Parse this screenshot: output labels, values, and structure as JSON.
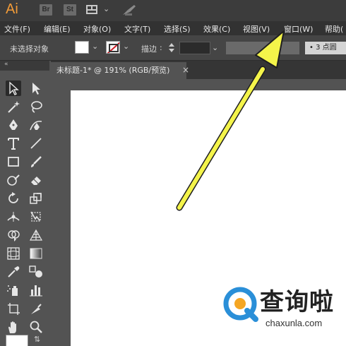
{
  "app": {
    "logo": "Ai",
    "buttons": [
      "Br",
      "St"
    ],
    "icons": [
      "layout-icon",
      "chevron-down-icon",
      "gpu-rocket-icon"
    ]
  },
  "menu": [
    {
      "label": "文件(F)"
    },
    {
      "label": "编辑(E)"
    },
    {
      "label": "对象(O)"
    },
    {
      "label": "文字(T)"
    },
    {
      "label": "选择(S)"
    },
    {
      "label": "效果(C)"
    },
    {
      "label": "视图(V)"
    },
    {
      "label": "窗口(W)"
    },
    {
      "label": "帮助("
    }
  ],
  "control_bar": {
    "selection_status": "未选择对象",
    "stroke_label": "描边",
    "stroke_colon": ":",
    "brush_label": "3 点圆",
    "fill_color": "#ffffff",
    "stroke_color": "none"
  },
  "document": {
    "tab_title": "未标题-1* @ 191% (RGB/预览)",
    "close_glyph": "×"
  },
  "annotation": {
    "arrow_color": "#f4f44a",
    "target": "窗口(W)"
  },
  "watermark": {
    "text": "查询啦",
    "url": "chaxunla.com",
    "brand_colors": [
      "#2a8fd8",
      "#f5a623"
    ]
  }
}
